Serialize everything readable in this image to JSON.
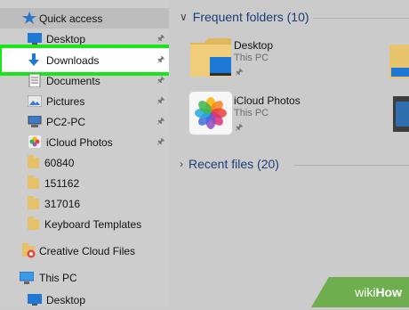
{
  "navigation": {
    "quick_access": "Quick access",
    "items": [
      {
        "label": "Desktop",
        "icon": "desktop-icon",
        "pinned": true
      },
      {
        "label": "Downloads",
        "icon": "download-arrow-icon",
        "pinned": true,
        "selected": true
      },
      {
        "label": "Documents",
        "icon": "documents-icon",
        "pinned": true
      },
      {
        "label": "Pictures",
        "icon": "pictures-icon",
        "pinned": true
      },
      {
        "label": "PC2-PC",
        "icon": "network-pc-icon",
        "pinned": true
      },
      {
        "label": "iCloud Photos",
        "icon": "icloud-photos-icon",
        "pinned": true
      },
      {
        "label": "60840",
        "icon": "folder-icon",
        "pinned": false
      },
      {
        "label": "151162",
        "icon": "folder-icon",
        "pinned": false
      },
      {
        "label": "317016",
        "icon": "folder-icon",
        "pinned": false
      },
      {
        "label": "Keyboard Templates",
        "icon": "folder-icon",
        "pinned": false
      }
    ],
    "creative_cloud": "Creative Cloud Files",
    "this_pc": "This PC",
    "this_pc_desktop": "Desktop"
  },
  "frequent_folders": {
    "title": "Frequent folders (10)",
    "tiles": [
      {
        "name": "Desktop",
        "location": "This PC"
      },
      {
        "name": "iCloud Photos",
        "location": "This PC"
      }
    ]
  },
  "recent_files": {
    "title": "Recent files (20)"
  },
  "watermark": {
    "wiki": "wiki",
    "how": "How"
  },
  "colors": {
    "selection_highlight": "#19e619",
    "section_header": "#1c3c78",
    "folder": "#e6c16a",
    "accent_blue": "#1e78d6"
  }
}
